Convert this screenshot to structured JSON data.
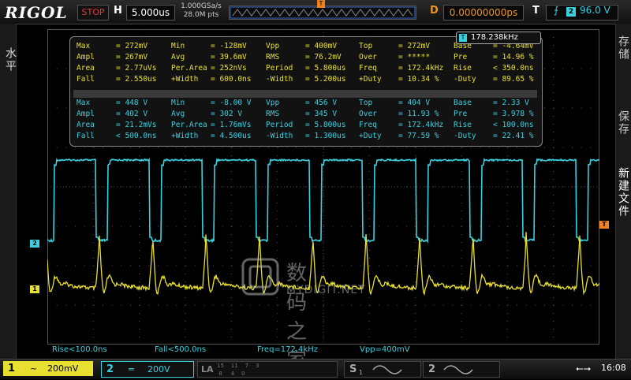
{
  "topbar": {
    "brand": "RIGOL",
    "run_state": "STOP",
    "horizontal_label": "H",
    "horizontal_scale": "5.000us",
    "sample_rate": "1.000GSa/s",
    "memory_depth": "28.0M pts",
    "delay_label": "D",
    "delay_value": "0.00000000ps",
    "trigger_label": "T",
    "trigger_channel": "2",
    "trigger_level": "96.0 V",
    "trigger_marker": "T"
  },
  "left_panel": {
    "label": "水平"
  },
  "right_panel": {
    "btn1": "存储",
    "btn2": "保存",
    "btn3": "新建文件"
  },
  "freq_badge": {
    "icon": "T",
    "value": "178.238kHz"
  },
  "measurements_ch1": [
    [
      [
        "Max",
        "= 272mV"
      ],
      [
        "Min",
        "= -128mV"
      ],
      [
        "Vpp",
        "= 400mV"
      ],
      [
        "Top",
        "= 272mV"
      ],
      [
        "Base",
        "= -4.64mV"
      ]
    ],
    [
      [
        "Ampl",
        "= 267mV"
      ],
      [
        "Avg",
        "= 39.6mV"
      ],
      [
        "RMS",
        "= 76.2mV"
      ],
      [
        "Over",
        "= *****"
      ],
      [
        "Pre",
        "= 14.96 %"
      ]
    ],
    [
      [
        "Area",
        "= 2.77uVs"
      ],
      [
        "Per.Area",
        "= 252nVs"
      ],
      [
        "Period",
        "= 5.800us"
      ],
      [
        "Freq",
        "= 172.4kHz"
      ],
      [
        "Rise",
        "< 350.0ns"
      ]
    ],
    [
      [
        "Fall",
        "= 2.550us"
      ],
      [
        "+Width",
        "= 600.0ns"
      ],
      [
        "-Width",
        "= 5.200us"
      ],
      [
        "+Duty",
        "= 10.34 %"
      ],
      [
        "-Duty",
        "= 89.65 %"
      ]
    ]
  ],
  "measurements_ch2": [
    [
      [
        "Max",
        "= 448 V"
      ],
      [
        "Min",
        "= -8.00 V"
      ],
      [
        "Vpp",
        "= 456 V"
      ],
      [
        "Top",
        "= 404 V"
      ],
      [
        "Base",
        "= 2.33 V"
      ]
    ],
    [
      [
        "Ampl",
        "= 402 V"
      ],
      [
        "Avg",
        "= 302 V"
      ],
      [
        "RMS",
        "= 345 V"
      ],
      [
        "Over",
        "= 11.93 %"
      ],
      [
        "Pre",
        "= 3.978 %"
      ]
    ],
    [
      [
        "Area",
        "= 21.2mVs"
      ],
      [
        "Per.Area",
        "= 1.76mVs"
      ],
      [
        "Period",
        "= 5.800us"
      ],
      [
        "Freq",
        "= 172.4kHz"
      ],
      [
        "Rise",
        "< 100.0ns"
      ]
    ],
    [
      [
        "Fall",
        "< 500.0ns"
      ],
      [
        "+Width",
        "= 4.500us"
      ],
      [
        "-Width",
        "= 1.300us"
      ],
      [
        "+Duty",
        "= 77.59 %"
      ],
      [
        "-Duty",
        "= 22.41 %"
      ]
    ]
  ],
  "bottom_meas": {
    "rise": "Rise<100.0ns",
    "fall": "Fall<500.0ns",
    "freq": "Freq=172.4kHz",
    "vpp": "Vpp=400mV"
  },
  "channels": {
    "ch1": {
      "num": "1",
      "coupling": "~",
      "scale": "200mV",
      "color": "#e8e030"
    },
    "ch2": {
      "num": "2",
      "coupling": "═",
      "scale": "200V",
      "color": "#3ad0e0"
    }
  },
  "la": {
    "label": "LA",
    "digits": "15    11    7    3\n 8     4    0"
  },
  "source1": {
    "num": "S",
    "sub": "1"
  },
  "source2": {
    "num": "2"
  },
  "status": {
    "clock": "16:08"
  },
  "watermark": {
    "line1": "数码之家",
    "line2": "MYDIGIT.NET"
  },
  "markers": {
    "ch1": "1",
    "ch2": "2",
    "trig_level": "T"
  },
  "colors": {
    "ch1": "#e8e030",
    "ch2": "#3ad0e0",
    "accent": "#f08020",
    "stop": "#e23b3b"
  }
}
